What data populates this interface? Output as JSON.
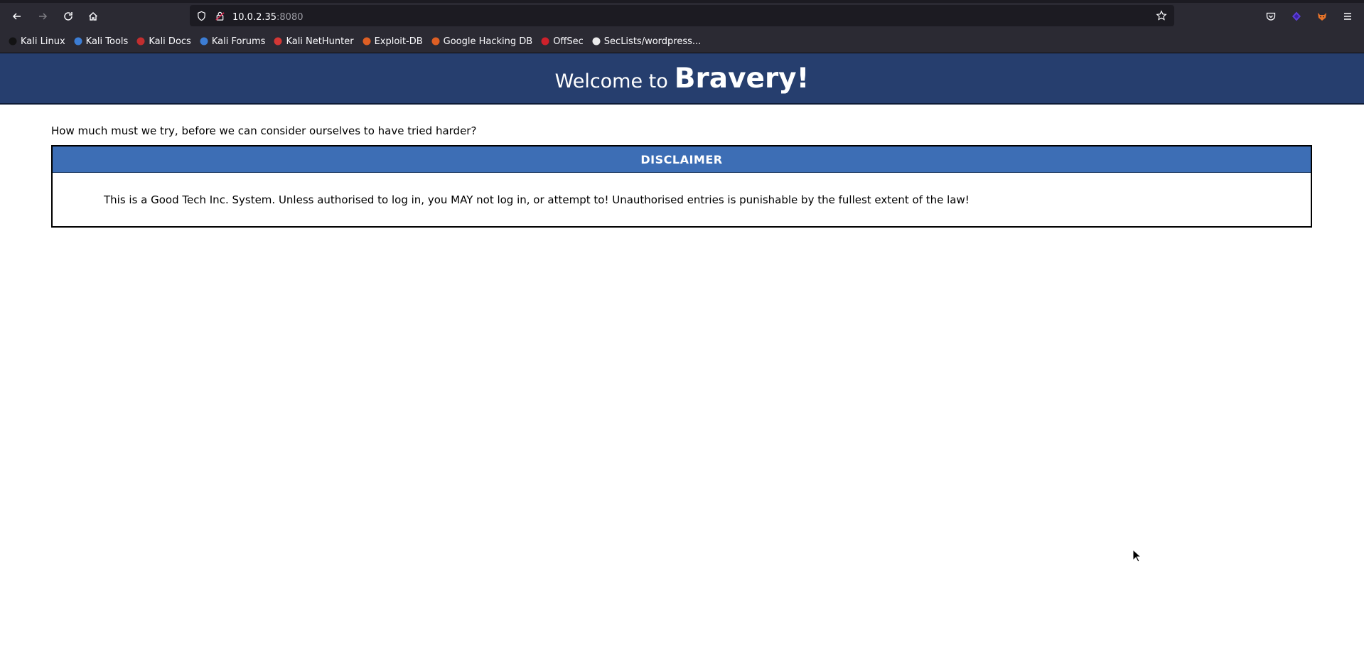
{
  "browser": {
    "url_host": "10.0.2.35",
    "url_port": ":8080",
    "bookmarks": [
      {
        "label": "Kali Linux",
        "icon": "kali-linux-icon",
        "color": "#111111"
      },
      {
        "label": "Kali Tools",
        "icon": "kali-tools-icon",
        "color": "#3e86e6"
      },
      {
        "label": "Kali Docs",
        "icon": "kali-docs-icon",
        "color": "#d32f2f"
      },
      {
        "label": "Kali Forums",
        "icon": "kali-forums-icon",
        "color": "#3e86e6"
      },
      {
        "label": "Kali NetHunter",
        "icon": "kali-nethunter-icon",
        "color": "#e53935"
      },
      {
        "label": "Exploit-DB",
        "icon": "exploit-db-icon",
        "color": "#f26522"
      },
      {
        "label": "Google Hacking DB",
        "icon": "google-hacking-db-icon",
        "color": "#f26522"
      },
      {
        "label": "OffSec",
        "icon": "offsec-icon",
        "color": "#e0202a"
      },
      {
        "label": "SecLists/wordpress...",
        "icon": "github-icon",
        "color": "#ffffff"
      }
    ]
  },
  "page": {
    "header_welcome": "Welcome to",
    "header_brand": "Bravery!",
    "tagline": "How much must we try, before we can consider ourselves to have tried harder?",
    "disclaimer_title": "DISCLAIMER",
    "disclaimer_text": "This is a Good Tech Inc. System. Unless authorised to log in, you MAY not log in, or attempt to! Unauthorised entries is punishable by the fullest extent of the law!"
  },
  "colors": {
    "header_bg": "#263e6e",
    "disclaimer_head_bg": "#3d6eb5",
    "chrome_bg": "#2b2a33"
  }
}
